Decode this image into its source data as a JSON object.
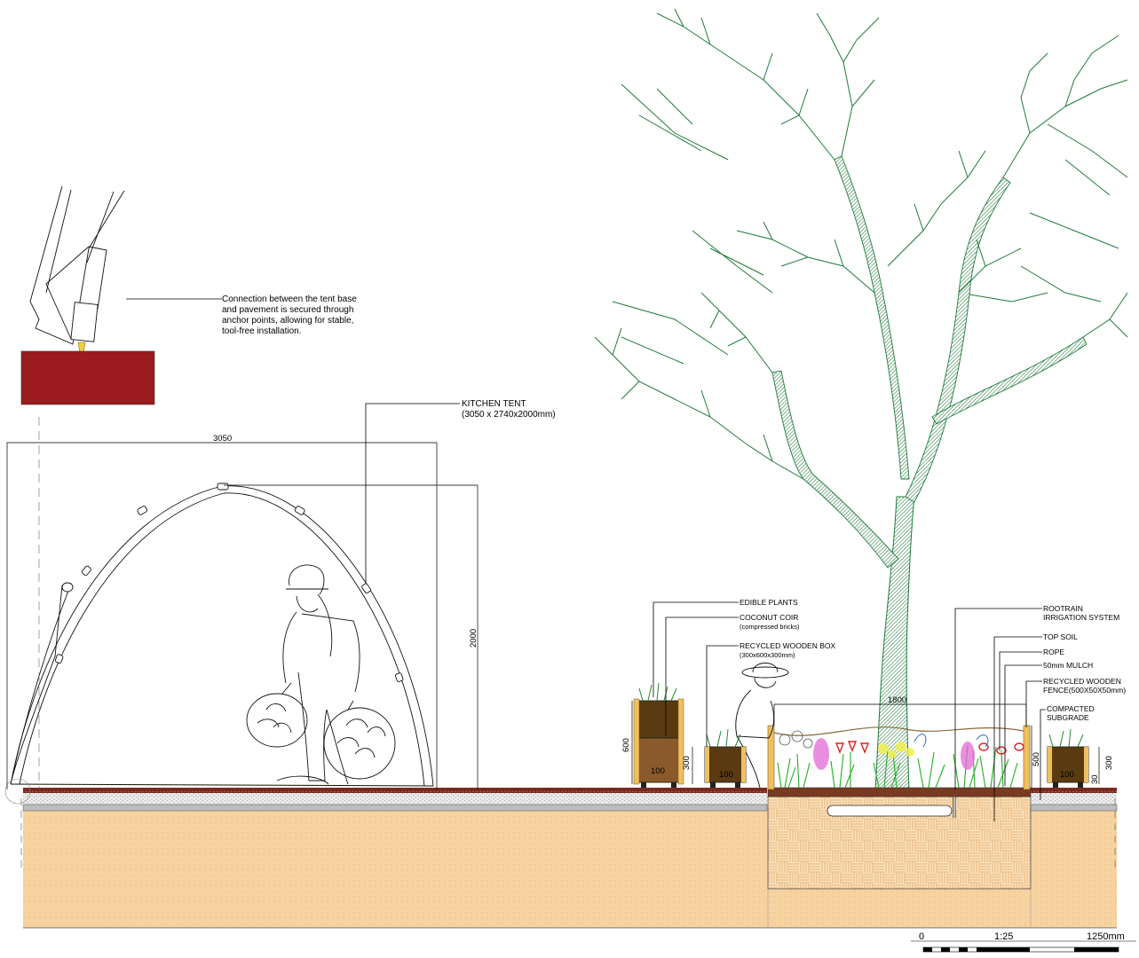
{
  "anchor_note": {
    "lines": [
      "Connection between the tent base",
      "and pavement is secured through",
      "anchor points, allowing for stable,",
      "tool-free installation."
    ]
  },
  "tent": {
    "title": "KITCHEN TENT",
    "size": "(3050 x 2740x2000mm)",
    "width_dim": "3050",
    "height_dim": "2000"
  },
  "planters": {
    "edible_plants": "EDIBLE PLANTS",
    "coconut_coir": "COCONUT COIR",
    "coconut_coir_sub": "(compressed bricks)",
    "wooden_box": "RECYCLED WOODEN BOX",
    "wooden_box_sub": "(300x600x300mm)",
    "dim_600": "600",
    "dim_100_a": "100",
    "dim_300_a": "300",
    "dim_100_b": "100",
    "dim_100_c": "100",
    "dim_300_b": "300",
    "dim_30": "30"
  },
  "bed": {
    "width_dim": "1800",
    "height_dim": "500",
    "rootrain": "ROOTRAIN",
    "rootrain_sub": "IRRIGATION SYSTEM",
    "top_soil": "TOP SOIL",
    "rope": "ROPE",
    "mulch": "50mm MULCH",
    "fence": "RECYCLED WOODEN",
    "fence_sub": "FENCE(500X50X50mm)",
    "subgrade": "COMPACTED",
    "subgrade_sub": "SUBGRADE"
  },
  "scale_bar": {
    "start": "0",
    "ratio": "1:25",
    "end": "1250mm"
  },
  "colors": {
    "tree": "#1f7a3a",
    "soil": "#f6d3a0",
    "anchor_block": "#9b1b1e",
    "pavement": "#7a2a20"
  }
}
